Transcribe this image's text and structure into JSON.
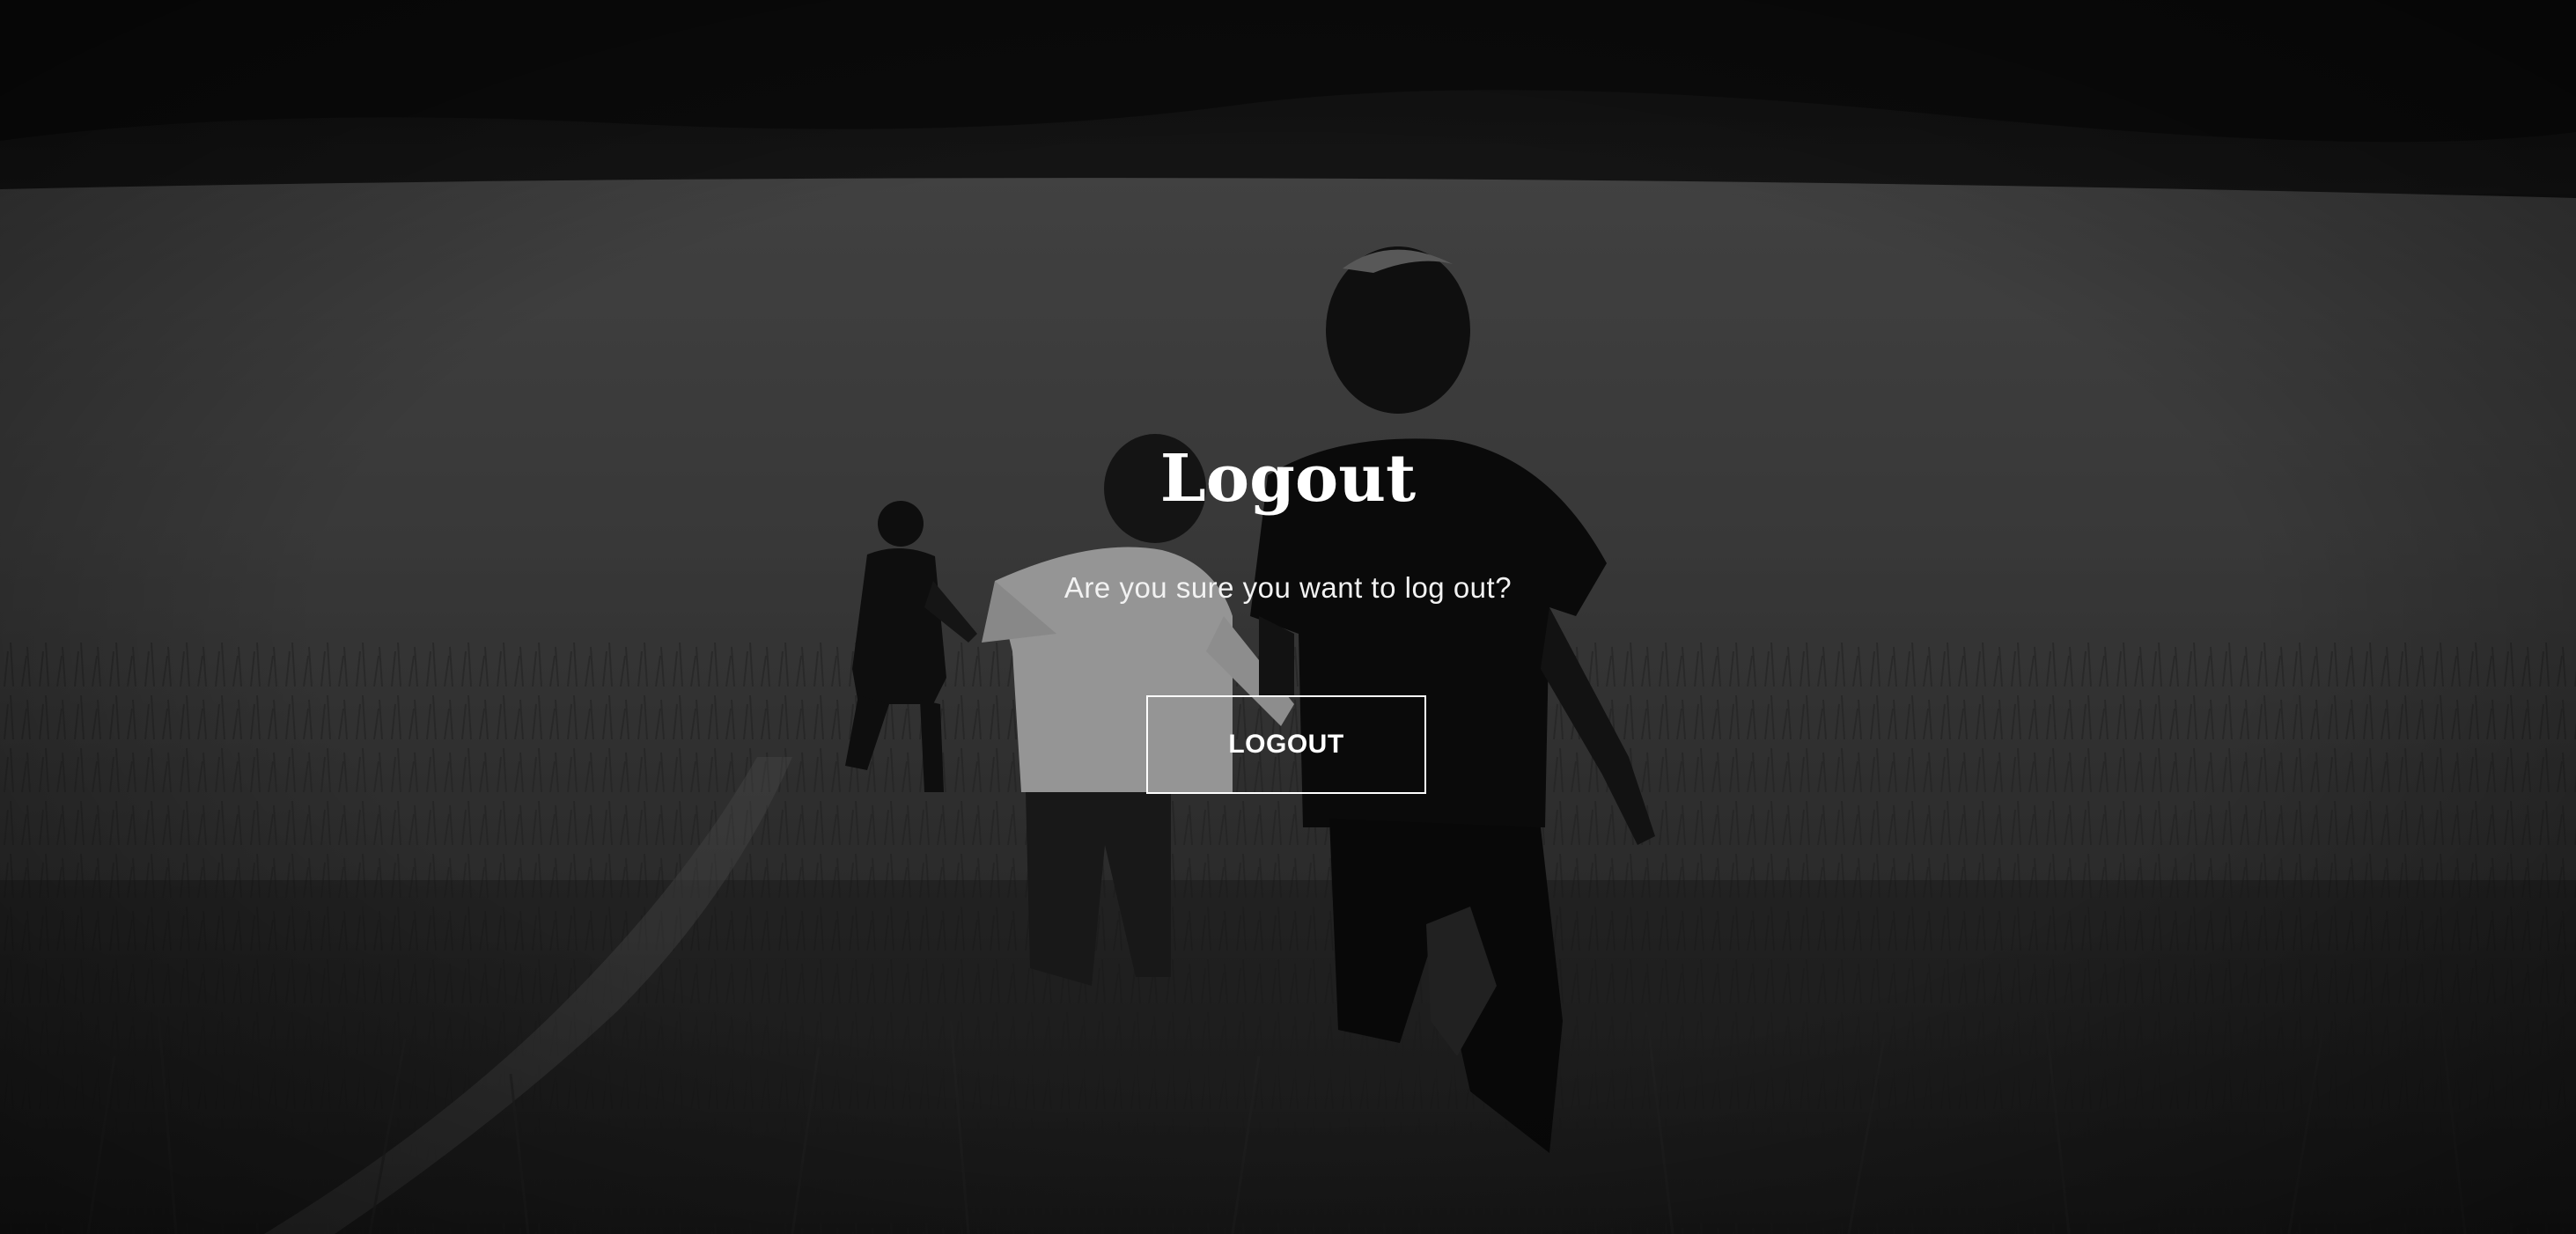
{
  "page": {
    "title": "Logout",
    "message": "Are you sure you want to log out?",
    "logout_button_label": "LOGOUT"
  },
  "colors": {
    "text": "#ffffff",
    "button_border": "#ffffff",
    "background_tone": "grayscale"
  },
  "background": {
    "image_subject": "three children running through a grassy field, black and white photo"
  }
}
